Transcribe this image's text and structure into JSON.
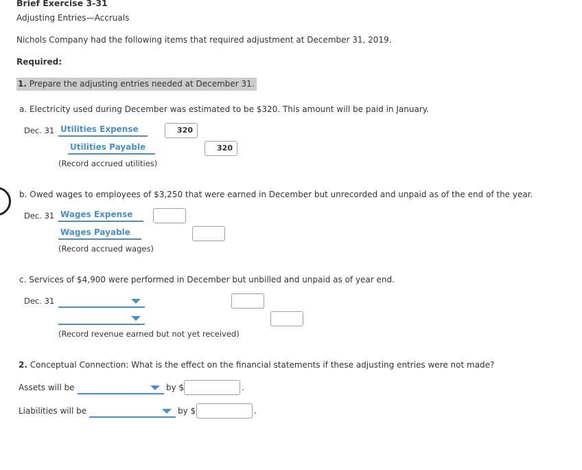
{
  "header": {
    "title": "Brief Exercise 3-31",
    "subtitle": "Adjusting Entries—Accruals",
    "intro": "Nichols Company had the following items that required adjustment at December 31, 2019.",
    "required_label": "Required:"
  },
  "part1": {
    "number": "1.",
    "prompt": "Prepare the adjusting entries needed at December 31."
  },
  "items": {
    "a": {
      "text": "a.  Electricity used during December was estimated to be $320. This amount will be paid in January.",
      "date": "Dec. 31",
      "debit_account": "Utilities Expense",
      "debit_value": "320",
      "credit_account": "Utilities Payable",
      "credit_value": "320",
      "note": "(Record accrued utilities)"
    },
    "b": {
      "text": "b.  Owed wages to employees of $3,250 that were earned in December but unrecorded and unpaid as of the end of the year.",
      "date": "Dec. 31",
      "debit_account": "Wages Expense",
      "debit_value": "",
      "credit_account": "Wages Payable",
      "credit_value": "",
      "note": "(Record accrued wages)"
    },
    "c": {
      "text": "c.  Services of $4,900 were performed in December but unbilled and unpaid as of year end.",
      "date": "Dec. 31",
      "debit_account": "",
      "debit_value": "",
      "credit_account": "",
      "credit_value": "",
      "note": "(Record revenue earned but not yet received)"
    }
  },
  "part2": {
    "number": "2.",
    "prompt": "Conceptual Connection: What is the effect on the financial statements if these adjusting entries were not made?",
    "assets_label": "Assets will be",
    "assets_selection": "",
    "assets_by": "by $",
    "assets_value": "",
    "liabilities_label": "Liabilities will be",
    "liabilities_selection": "",
    "liabilities_by": "by $",
    "liabilities_value": "",
    "period": "."
  },
  "colors": {
    "accent": "#4a8fc7",
    "highlight": "#cccccc",
    "text": "#333333"
  }
}
